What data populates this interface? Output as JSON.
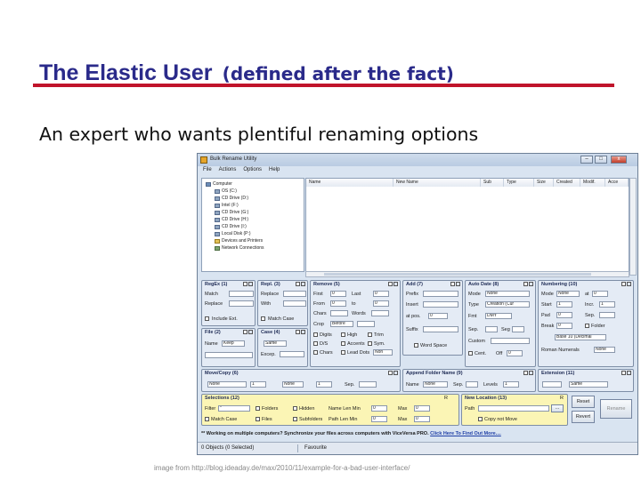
{
  "slide": {
    "title_main": "The Elastic User",
    "title_paren": "(defined after the fact)",
    "subtitle": "An expert who wants plentiful renaming options",
    "caption": "image from http://blog.ideaday.de/max/2010/11/example-for-a-bad-user-interface/"
  },
  "colors": {
    "title": "#2a2a8a",
    "rule": "#c0142b",
    "window_bg": "#d9e4f1",
    "panel_yellow": "#fbf5b5"
  },
  "window": {
    "title": "Bulk Rename Utility",
    "buttons": {
      "minimize": "–",
      "maximize": "□",
      "close": "x"
    },
    "menu": [
      "File",
      "Actions",
      "Options",
      "Help"
    ]
  },
  "tree": [
    "Computer",
    "OS (C:)",
    "CD Drive (D:)",
    "Intel (F:)",
    "CD Drive (G:)",
    "CD Drive (H:)",
    "CD Drive (I:)",
    "Local Disk (P:)",
    "Devices and Printers",
    "Network Connections"
  ],
  "columns": [
    "Name",
    "New Name",
    "Sub",
    "Type",
    "Size",
    "Created",
    "Modif.",
    "Acce"
  ],
  "panels": {
    "regex": {
      "title": "RegEx (1)",
      "match": "Match",
      "replace": "Replace",
      "include_ext": "Include Ext."
    },
    "repl": {
      "title": "Repl. (3)",
      "replace": "Replace",
      "with": "With",
      "match_case": "Match Case"
    },
    "remove": {
      "title": "Remove (5)",
      "first": "First",
      "last": "Last",
      "from": "From",
      "to": "to",
      "chars": "Chars",
      "words": "Words",
      "crop": "Crop",
      "crop_value": "Before",
      "first_n": "0",
      "last_n": "0",
      "from_n": "0",
      "to_n": "0",
      "digits": "Digits",
      "high": "High",
      "trim": "Trim",
      "ds": "D/S",
      "accents": "Accents",
      "sym": "Sym.",
      "chars2": "Chars",
      "lead_dots": "Lead Dots",
      "non": "Non"
    },
    "add": {
      "title": "Add (7)",
      "prefix": "Prefix",
      "insert": "Insert",
      "at_pos": "at pos.",
      "at_value": "0",
      "suffix": "Suffix",
      "word_space": "Word Space"
    },
    "autodate": {
      "title": "Auto Date (8)",
      "mode": "Mode",
      "mode_value": "None",
      "type": "Type",
      "type_value": "Creation (Cur",
      "fmt": "Fmt",
      "fmt_value": "DMY",
      "sep": "Sep.",
      "seg": "Seg",
      "custom": "Custom",
      "cent": "Cent.",
      "off": "Off",
      "off_value": "0"
    },
    "numbering": {
      "title": "Numbering (10)",
      "mode": "Mode",
      "mode_value": "None",
      "at": "at",
      "at_value": "0",
      "start": "Start",
      "start_value": "1",
      "incr": "Incr.",
      "incr_value": "1",
      "pad": "Pad",
      "pad_value": "0",
      "sep": "Sep.",
      "break": "Break",
      "break_value": "0",
      "folder": "Folder",
      "type_value": "Base 10 (Decimal",
      "roman": "Roman Numerals",
      "roman_value": "None"
    },
    "file": {
      "title": "File (2)",
      "name": "Name",
      "name_value": "Keep"
    },
    "case": {
      "title": "Case (4)",
      "case_value": "Same",
      "excep": "Excep."
    },
    "movecopy": {
      "title": "Move/Copy (6)",
      "mode_value": "None",
      "num_value": "1",
      "mode2_value": "None",
      "num2_value": "1",
      "sep": "Sep."
    },
    "append": {
      "title": "Append Folder Name (9)",
      "name": "Name",
      "name_value": "None",
      "sep": "Sep.",
      "levels": "Levels",
      "levels_value": "1"
    },
    "extension": {
      "title": "Extension (11)",
      "value": "Same"
    },
    "selections": {
      "title": "Selections (12)",
      "filter": "Filter",
      "filter_value": "*",
      "folders": "Folders",
      "hidden": "Hidden",
      "name_len_min": "Name Len Min",
      "min_value": "0",
      "max": "Max",
      "max_value": "0",
      "match_case": "Match Case",
      "files": "Files",
      "subfolders": "Subfolders",
      "path_len_min": "Path Len Min",
      "pmin_value": "0",
      "pmax": "Max",
      "pmax_value": "0",
      "r": "R"
    },
    "newloc": {
      "title": "New Location (13)",
      "path": "Path",
      "copy_not_move": "Copy not Move",
      "browse": "...",
      "r": "R"
    }
  },
  "buttons": {
    "reset": "Reset",
    "revert": "Revert",
    "rename": "Rename"
  },
  "promo": {
    "text": "** Working on multiple computers? Synchronize your files across computers with ViceVersa PRO. ",
    "link": "Click Here To Find Out More...."
  },
  "status": {
    "objects": "0 Objects (0 Selected)",
    "favourite": "Favourite"
  }
}
